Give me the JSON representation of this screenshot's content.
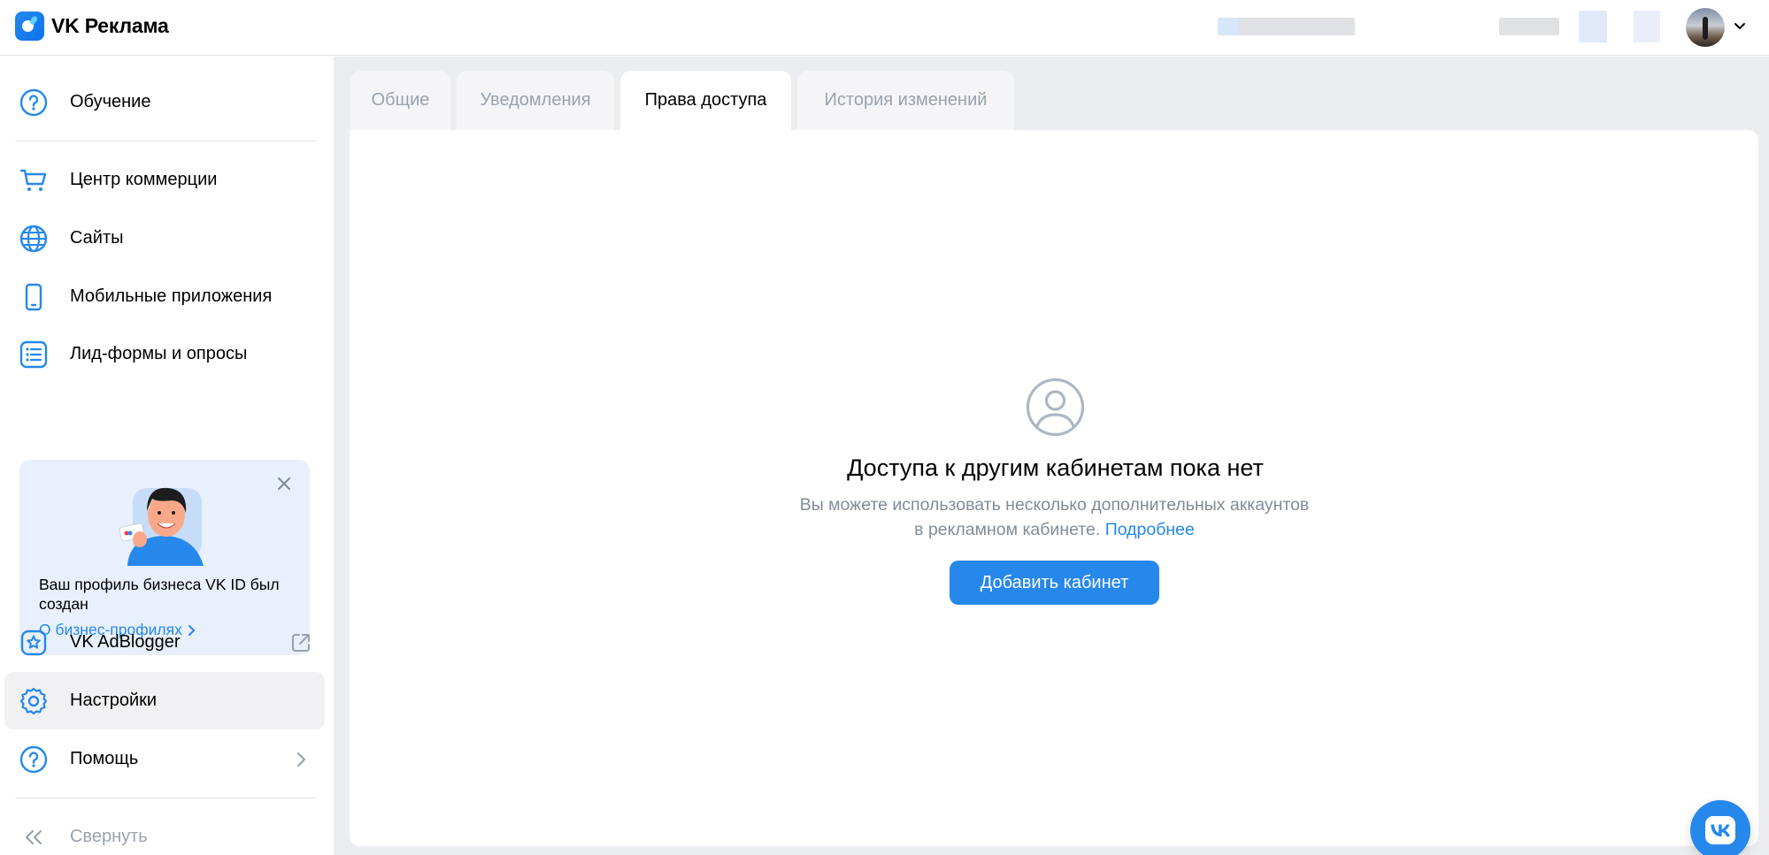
{
  "header": {
    "logo_text": "VK Реклама",
    "logo_icon": "vk-ads-logo-icon",
    "avatar_icon": "user-avatar",
    "chevron_icon": "chevron-down-icon"
  },
  "sidebar": {
    "items": [
      {
        "label": "Обучение",
        "icon": "question-circle-icon"
      },
      {
        "label": "Центр коммерции",
        "icon": "cart-icon"
      },
      {
        "label": "Сайты",
        "icon": "globe-icon"
      },
      {
        "label": "Мобильные приложения",
        "icon": "smartphone-icon"
      },
      {
        "label": "Лид-формы и опросы",
        "icon": "list-icon"
      },
      {
        "label": "VK AdBlogger",
        "icon": "star-badge-icon",
        "right_icon": "external-link-icon"
      },
      {
        "label": "Настройки",
        "icon": "gear-icon",
        "active": true
      },
      {
        "label": "Помощь",
        "icon": "question-circle-icon",
        "right_icon": "chevron-right-icon"
      },
      {
        "label": "Свернуть",
        "icon": "double-chevron-left-icon"
      }
    ],
    "promo": {
      "text": "Ваш профиль бизнеса VK ID был создан",
      "link": "О бизнес-профилях",
      "close_icon": "close-icon"
    }
  },
  "tabs": [
    {
      "label": "Общие",
      "active": false
    },
    {
      "label": "Уведомления",
      "active": false
    },
    {
      "label": "Права доступа",
      "active": true
    },
    {
      "label": "История изменений",
      "active": false
    }
  ],
  "empty_state": {
    "icon": "user-circle-icon",
    "title": "Доступа к другим кабинетам пока нет",
    "description_line1": "Вы можете использовать несколько дополнительных аккаунтов",
    "description_line2": "в рекламном кабинете.",
    "link": "Подробнее",
    "button": "Добавить кабинет"
  },
  "fab_icon": "vk-logo-icon",
  "colors": {
    "accent": "#2688eb",
    "muted_text": "#99a2ad",
    "page_bg": "#ebedf0",
    "active_nav_bg": "#f1f1f3",
    "promo_bg": "#e8f0fb"
  }
}
